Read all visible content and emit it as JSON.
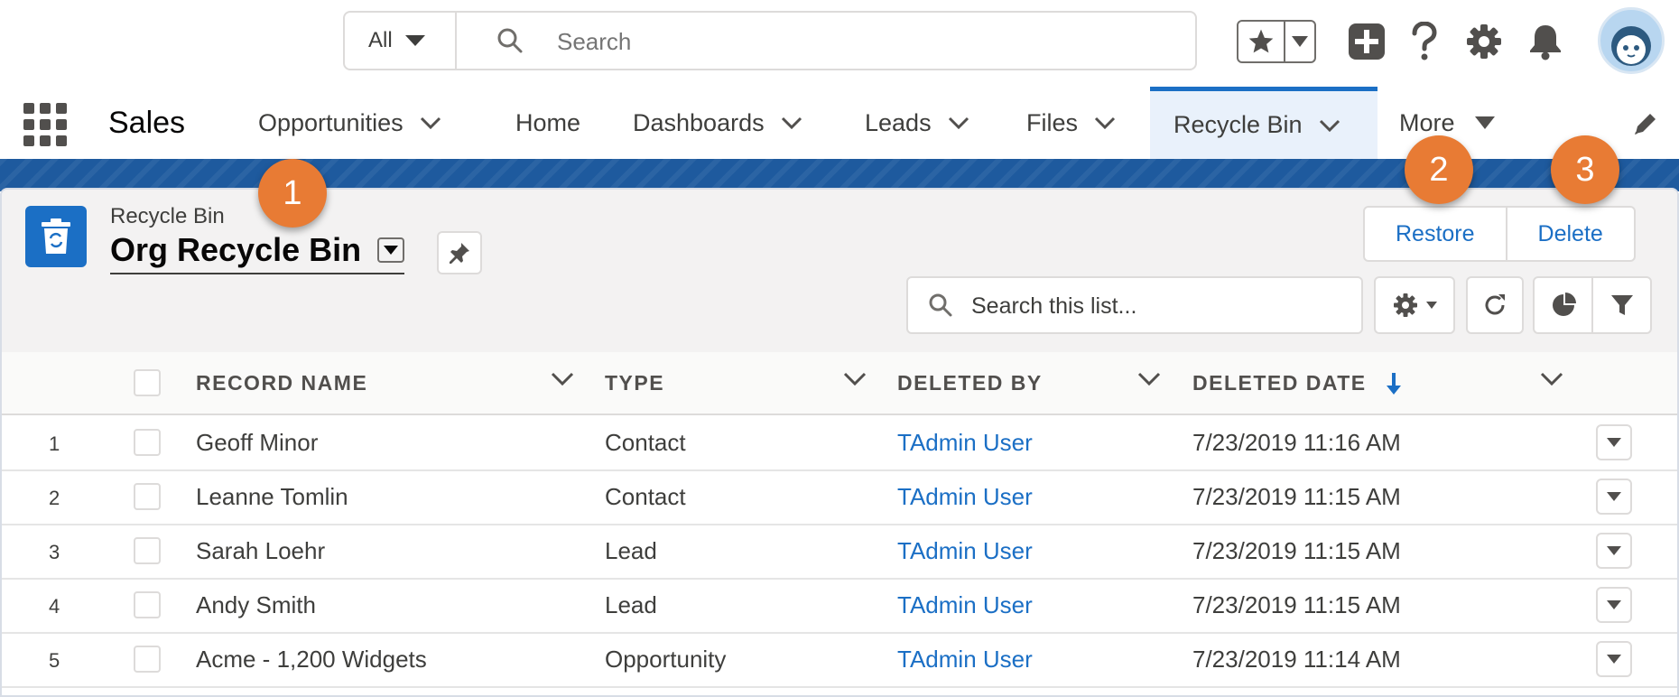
{
  "global_header": {
    "search_scope": "All",
    "search_placeholder": "Search",
    "icons": [
      "star-icon",
      "chevron-down-icon",
      "add-icon",
      "help-icon",
      "setup-gear-icon",
      "notification-bell-icon",
      "avatar"
    ]
  },
  "nav": {
    "app_name": "Sales",
    "items": [
      {
        "label": "Opportunities",
        "has_menu": true
      },
      {
        "label": "Home",
        "has_menu": false
      },
      {
        "label": "Dashboards",
        "has_menu": true
      },
      {
        "label": "Leads",
        "has_menu": true
      },
      {
        "label": "Files",
        "has_menu": true
      },
      {
        "label": "Recycle Bin",
        "has_menu": true,
        "active": true
      },
      {
        "label": "More",
        "has_menu": true
      }
    ]
  },
  "list_header": {
    "object_label": "Recycle Bin",
    "list_view_name": "Org Recycle Bin",
    "actions": {
      "restore": "Restore",
      "delete": "Delete"
    },
    "search_placeholder": "Search this list..."
  },
  "table": {
    "columns": [
      "RECORD NAME",
      "TYPE",
      "DELETED BY",
      "DELETED DATE"
    ],
    "sort_column": "DELETED DATE",
    "sort_direction": "descending",
    "rows": [
      {
        "num": "1",
        "name": "Geoff Minor",
        "type": "Contact",
        "deleted_by": "TAdmin User",
        "deleted_date": "7/23/2019 11:16 AM"
      },
      {
        "num": "2",
        "name": "Leanne Tomlin",
        "type": "Contact",
        "deleted_by": "TAdmin User",
        "deleted_date": "7/23/2019 11:15 AM"
      },
      {
        "num": "3",
        "name": "Sarah Loehr",
        "type": "Lead",
        "deleted_by": "TAdmin User",
        "deleted_date": "7/23/2019 11:15 AM"
      },
      {
        "num": "4",
        "name": "Andy Smith",
        "type": "Lead",
        "deleted_by": "TAdmin User",
        "deleted_date": "7/23/2019 11:15 AM"
      },
      {
        "num": "5",
        "name": "Acme - 1,200 Widgets",
        "type": "Opportunity",
        "deleted_by": "TAdmin User",
        "deleted_date": "7/23/2019 11:14 AM"
      }
    ]
  },
  "callouts": [
    "1",
    "2",
    "3"
  ],
  "colors": {
    "brand_blue": "#1b6fc5",
    "callout_orange": "#e87b34",
    "band_blue": "#1e5a9e"
  }
}
